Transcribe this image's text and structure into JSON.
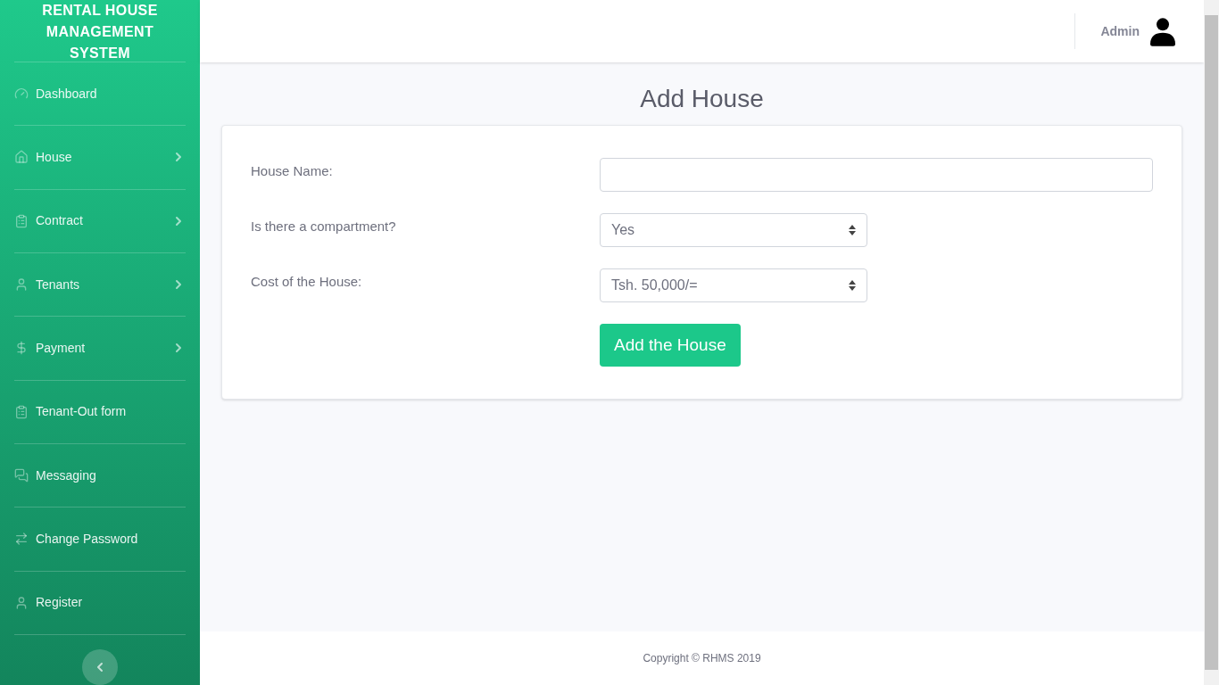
{
  "sidebar": {
    "brand": "RENTAL HOUSE MANAGEMENT SYSTEM",
    "items": [
      {
        "label": "Dashboard",
        "kind": "dashboard",
        "has_submenu": false
      },
      {
        "label": "House",
        "kind": "house",
        "has_submenu": true
      },
      {
        "label": "Contract",
        "kind": "clipboard",
        "has_submenu": true
      },
      {
        "label": "Tenants",
        "kind": "person",
        "has_submenu": true
      },
      {
        "label": "Payment",
        "kind": "dollar",
        "has_submenu": true
      },
      {
        "label": "Tenant-Out form",
        "kind": "clipboard",
        "has_submenu": false
      },
      {
        "label": "Messaging",
        "kind": "chat",
        "has_submenu": false
      },
      {
        "label": "Change Password",
        "kind": "swap",
        "has_submenu": false
      },
      {
        "label": "Register",
        "kind": "person",
        "has_submenu": false
      }
    ]
  },
  "topbar": {
    "user": "Admin"
  },
  "page_title": "Add House",
  "form": {
    "fields": [
      {
        "label": "House Name:",
        "kind": "text"
      },
      {
        "label": "Is there a compartment?",
        "kind": "select",
        "value": "Yes"
      },
      {
        "label": "Cost of the House:",
        "kind": "select",
        "value": "Tsh. 50,000/="
      }
    ],
    "submit": "Add the House"
  },
  "footer": "Copyright © RHMS 2019"
}
